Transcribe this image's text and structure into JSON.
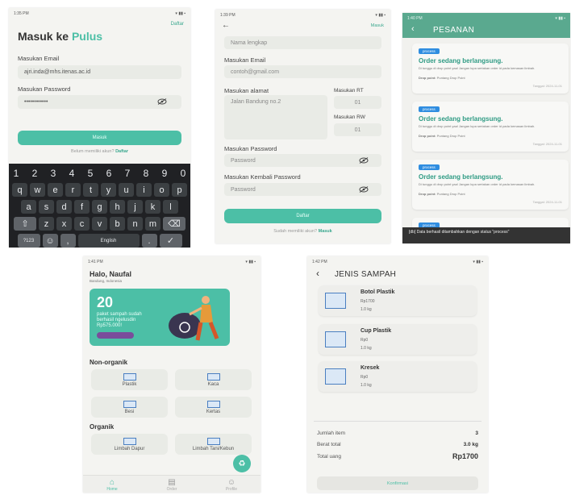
{
  "login": {
    "status_time": "1:35 PM",
    "register_link": "Daftar",
    "title_prefix": "Masuk ke",
    "title_brand": "Pulus",
    "email_label": "Masukan Email",
    "email_value": "ajri.inda@mhs.itenas.ac.id",
    "password_label": "Masukan Password",
    "password_value": "••••••••••••",
    "submit_label": "Masuk",
    "no_account_text": "Belum memiliki akun?",
    "no_account_link": "Daftar",
    "keyboard": {
      "numbers": [
        "1",
        "2",
        "3",
        "4",
        "5",
        "6",
        "7",
        "8",
        "9",
        "0"
      ],
      "row1": [
        "q",
        "w",
        "e",
        "r",
        "t",
        "y",
        "u",
        "i",
        "o",
        "p"
      ],
      "row2": [
        "a",
        "s",
        "d",
        "f",
        "g",
        "h",
        "j",
        "k",
        "l"
      ],
      "row3": [
        "z",
        "x",
        "c",
        "v",
        "b",
        "n",
        "m"
      ],
      "shift": "⇧",
      "backspace": "⌫",
      "sym": "?123",
      "emoji": "☺",
      "comma": ",",
      "space": "English",
      "period": ".",
      "enter": "✓"
    }
  },
  "register": {
    "status_time": "1:39 PM",
    "back_icon": "arrow-left-icon",
    "login_link": "Masuk",
    "name_placeholder": "Nama lengkap",
    "email_label": "Masukan Email",
    "email_placeholder": "contoh@gmail.com",
    "address_label": "Masukan alamat",
    "address_value": "Jalan Bandung no.2",
    "rt_label": "Masukan RT",
    "rt_value": "01",
    "rw_label": "Masukan RW",
    "rw_value": "01",
    "password_label": "Masukan Password",
    "password_placeholder": "Password",
    "password2_label": "Masukan Kembali Password",
    "password2_placeholder": "Password",
    "submit_label": "Daftar",
    "has_account_text": "Sudah memiliki akun?",
    "has_account_link": "Masuk"
  },
  "orders": {
    "status_time": "1:40 PM",
    "title": "PESANAN",
    "cards": [
      {
        "badge": "process",
        "title": "Order sedang berlangsung.",
        "desc": "Di tunggu di drop point yaa! Jangan lupa sertakan order id pada kemasan limbah.",
        "dp_label": "Drop point:",
        "dp_value": "Puntang Drop Point",
        "date": "Tanggal: 2024-11-01"
      },
      {
        "badge": "process",
        "title": "Order sedang berlangsung.",
        "desc": "Di tunggu di drop point yaa! Jangan lupa sertakan order id pada kemasan limbah.",
        "dp_label": "Drop point:",
        "dp_value": "Puntang Drop Point",
        "date": "Tanggal: 2024-11-01"
      },
      {
        "badge": "process",
        "title": "Order sedang berlangsung.",
        "desc": "Di tunggu di drop point yaa! Jangan lupa sertakan order id pada kemasan limbah.",
        "dp_label": "Drop point:",
        "dp_value": "Puntang Drop Point",
        "date": "Tanggal: 2024-11-01"
      }
    ],
    "last_badge": "process",
    "snackbar": "[db] Data berhasil ditambahkan dengan status \"process\""
  },
  "home": {
    "status_time": "1:41 PM",
    "greeting": "Halo, Naufal",
    "location": "Bandung, Indonesia",
    "banner_count": "20",
    "banner_line1": "paket sampah sudah",
    "banner_line2": "berhasil ngelusdin",
    "banner_line3": "Rp575.000!",
    "section1": "Non-organik",
    "non_organic": [
      "Plastik",
      "Kaca",
      "Besi",
      "Kertas"
    ],
    "section2": "Organik",
    "organic": [
      "Limbah Dapur",
      "Limbah Tani/Kebun"
    ],
    "fab_icon": "recycle-icon",
    "nav": [
      {
        "icon": "home-icon",
        "label": "Home"
      },
      {
        "icon": "order-icon",
        "label": "Order"
      },
      {
        "icon": "profile-icon",
        "label": "Profile"
      }
    ]
  },
  "jenis": {
    "status_time": "1:42 PM",
    "title": "JENIS SAMPAH",
    "items": [
      {
        "name": "Botol Plastik",
        "price": "Rp1700",
        "weight": "1.0 kg"
      },
      {
        "name": "Cup Plastik",
        "price": "Rp0",
        "weight": "1.0 kg"
      },
      {
        "name": "Kresek",
        "price": "Rp0",
        "weight": "1.0 kg"
      }
    ],
    "jumlah_label": "Jumlah item",
    "jumlah_value": "3",
    "berat_label": "Berat total",
    "berat_value": "3.0 kg",
    "total_label": "Total uang",
    "total_value": "Rp1700",
    "confirm_label": "Konfirmasi"
  },
  "colors": {
    "primary": "#4cbfa6",
    "primary_dark": "#2f9b84",
    "header": "#5aa98f",
    "badge_blue": "#2f8de0",
    "keyboard_bg": "#202124"
  }
}
